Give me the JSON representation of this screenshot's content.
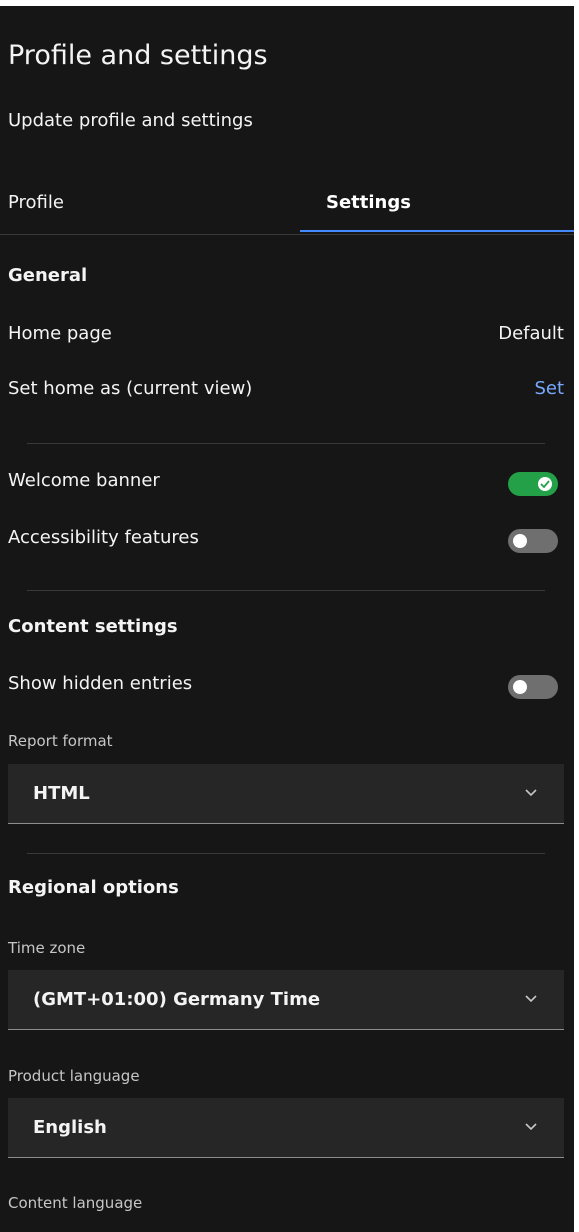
{
  "header": {
    "title": "Profile and settings",
    "subtitle": "Update profile and settings"
  },
  "tabs": [
    {
      "label": "Profile",
      "selected": false
    },
    {
      "label": "Settings",
      "selected": true
    }
  ],
  "general": {
    "title": "General",
    "home_page_label": "Home page",
    "home_page_value": "Default",
    "set_home_label": "Set home as (current view)",
    "set_home_link": "Set",
    "welcome_banner_label": "Welcome banner",
    "welcome_banner_on": true,
    "accessibility_label": "Accessibility features",
    "accessibility_on": false
  },
  "content_settings": {
    "title": "Content settings",
    "show_hidden_label": "Show hidden entries",
    "show_hidden_on": false,
    "report_format_label": "Report format",
    "report_format_value": "HTML"
  },
  "regional": {
    "title": "Regional options",
    "time_zone_label": "Time zone",
    "time_zone_value": "(GMT+01:00) Germany Time",
    "product_language_label": "Product language",
    "product_language_value": "English",
    "content_language_label": "Content language"
  },
  "colors": {
    "background": "#161616",
    "accent": "#4589ff",
    "link": "#78a9ff",
    "toggle_on": "#24a148",
    "toggle_off": "#6f6f6f"
  },
  "icons": {
    "chevron": "chevron-down-icon",
    "check": "checkmark-icon"
  }
}
